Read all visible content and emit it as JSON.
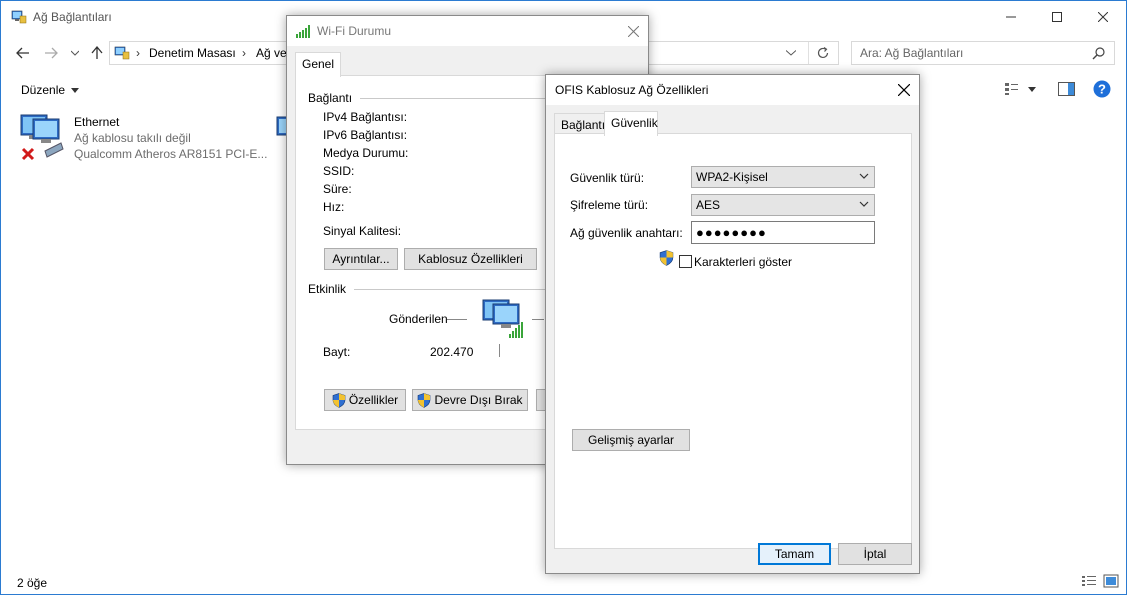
{
  "explorer": {
    "title": "Ağ Bağlantıları",
    "breadcrumb": [
      "Denetim Masası",
      "Ağ ve"
    ],
    "search_placeholder": "Ara: Ağ Bağlantıları",
    "organize_label": "Düzenle",
    "items": [
      {
        "name": "Ethernet",
        "status": "Ağ kablosu takılı değil",
        "adapter": "Qualcomm Atheros AR8151 PCI-E..."
      }
    ],
    "status_bar": "2 öğe"
  },
  "wifi_status": {
    "title": "Wi-Fi Durumu",
    "tab": "Genel",
    "section_connection": "Bağlantı",
    "fields": [
      "IPv4 Bağlantısı:",
      "IPv6 Bağlantısı:",
      "Medya Durumu:",
      "SSID:",
      "Süre:",
      "Hız:"
    ],
    "signal_quality_label": "Sinyal Kalitesi:",
    "details_button": "Ayrıntılar...",
    "wireless_props_button": "Kablosuz Özellikleri",
    "section_activity": "Etkinlik",
    "sent_label": "Gönderilen",
    "bytes_label": "Bayt:",
    "bytes_sent": "202.470",
    "properties_button": "Özellikler",
    "disable_button": "Devre Dışı Bırak"
  },
  "properties": {
    "title": "OFIS Kablosuz Ağ Özellikleri",
    "tabs": [
      "Bağlantı",
      "Güvenlik"
    ],
    "active_tab": "Güvenlik",
    "security_type_label": "Güvenlik türü:",
    "security_type_value": "WPA2-Kişisel",
    "encryption_type_label": "Şifreleme türü:",
    "encryption_type_value": "AES",
    "key_label": "Ağ güvenlik anahtarı:",
    "key_value": "●●●●●●●●",
    "show_chars_label": "Karakterleri göster",
    "show_chars_checked": false,
    "advanced_button": "Gelişmiş ayarlar",
    "ok_button": "Tamam",
    "cancel_button": "İptal"
  },
  "colors": {
    "accent": "#0078d7",
    "help_blue": "#1e6fd9",
    "error_red": "#d11a1a",
    "signal_green": "#3aa53a"
  }
}
